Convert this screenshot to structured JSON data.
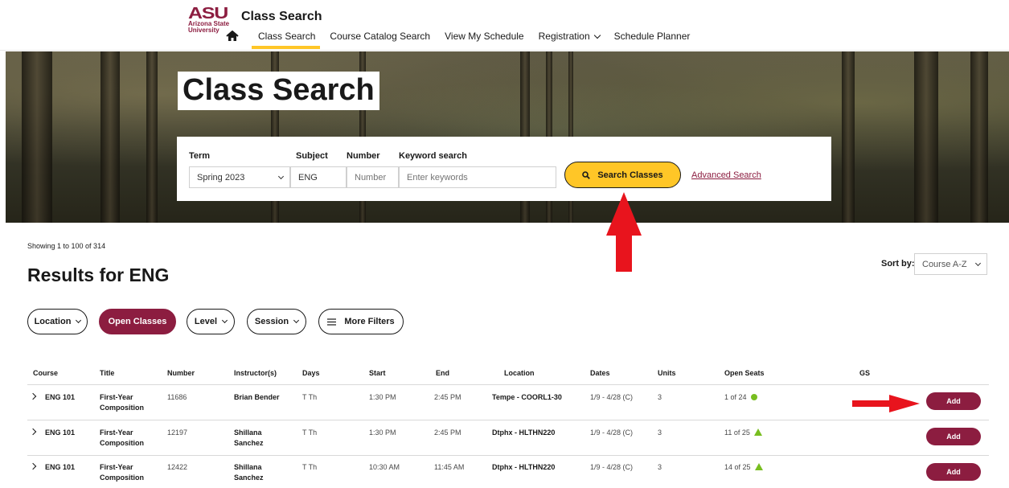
{
  "brand": {
    "logo_mark": "ASU",
    "logo_name_line1": "Arizona State",
    "logo_name_line2": "University",
    "site_title": "Class Search"
  },
  "nav": {
    "items": [
      "Class Search",
      "Course Catalog Search",
      "View My Schedule",
      "Registration",
      "Schedule Planner"
    ],
    "active": "Class Search"
  },
  "hero": {
    "title": "Class Search"
  },
  "search": {
    "term_label": "Term",
    "term_value": "Spring 2023",
    "subject_label": "Subject",
    "subject_value": "ENG",
    "number_label": "Number",
    "number_placeholder": "Number",
    "keyword_label": "Keyword search",
    "keyword_placeholder": "Enter keywords",
    "search_button": "Search Classes",
    "advanced_link": "Advanced Search"
  },
  "results": {
    "showing": "Showing 1 to 100 of 314",
    "title": "Results for ENG",
    "sort_label": "Sort by:",
    "sort_value": "Course A-Z"
  },
  "filters": [
    "Location",
    "Open Classes",
    "Level",
    "Session",
    "More Filters"
  ],
  "table": {
    "headers": [
      "Course",
      "Title",
      "Number",
      "Instructor(s)",
      "Days",
      "Start",
      "End",
      "Location",
      "Dates",
      "Units",
      "Open Seats",
      "GS"
    ],
    "rows": [
      {
        "course": "ENG 101",
        "title1": "First-Year",
        "title2": "Composition",
        "number": "11686",
        "instr1": "Brian Bender",
        "instr2": "",
        "days": "T Th",
        "start": "1:30 PM",
        "end": "2:45 PM",
        "location": "Tempe - COORL1-30",
        "dates": "1/9 - 4/28 (C)",
        "units": "3",
        "seats": "1 of 24",
        "add": "Add"
      },
      {
        "course": "ENG 101",
        "title1": "First-Year",
        "title2": "Composition",
        "number": "12197",
        "instr1": "Shillana",
        "instr2": "Sanchez",
        "days": "T Th",
        "start": "1:30 PM",
        "end": "2:45 PM",
        "location": "Dtphx - HLTHN220",
        "dates": "1/9 - 4/28 (C)",
        "units": "3",
        "seats": "11 of 25",
        "add": "Add"
      },
      {
        "course": "ENG 101",
        "title1": "First-Year",
        "title2": "Composition",
        "number": "12422",
        "instr1": "Shillana",
        "instr2": "Sanchez",
        "days": "T Th",
        "start": "10:30 AM",
        "end": "11:45 AM",
        "location": "Dtphx - HLTHN220",
        "dates": "1/9 - 4/28 (C)",
        "units": "3",
        "seats": "14 of 25",
        "add": "Add"
      }
    ]
  },
  "colors": {
    "maroon": "#8c1d40",
    "gold": "#ffc627",
    "annotation_red": "#e8141d",
    "seat_green": "#78be20"
  }
}
